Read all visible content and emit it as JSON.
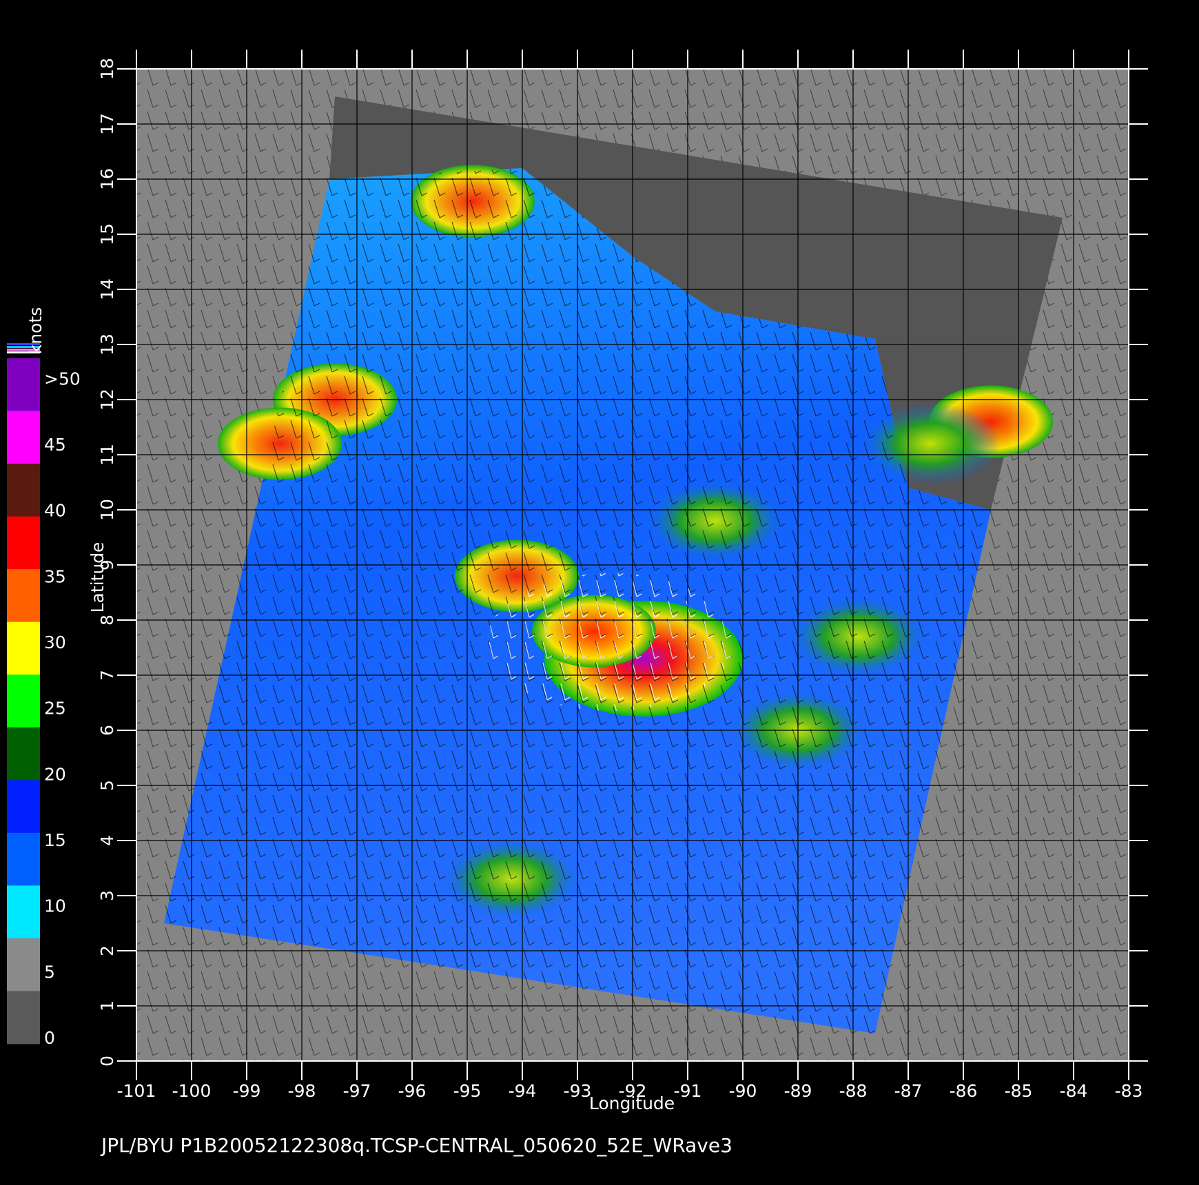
{
  "chart_data": {
    "type": "heatmap",
    "title": "",
    "xlabel": "Longitude",
    "ylabel": "Latitude",
    "xlim": [
      -101,
      -83
    ],
    "ylim": [
      0,
      18
    ],
    "x_ticks": [
      "-101",
      "-100",
      "-99",
      "-98",
      "-97",
      "-96",
      "-95",
      "-94",
      "-93",
      "-92",
      "-91",
      "-90",
      "-89",
      "-88",
      "-87",
      "-86",
      "-85",
      "-84",
      "-83"
    ],
    "y_ticks": [
      "0",
      "1",
      "2",
      "3",
      "4",
      "5",
      "6",
      "7",
      "8",
      "9",
      "10",
      "11",
      "12",
      "13",
      "14",
      "15",
      "16",
      "17",
      "18"
    ],
    "grid": true,
    "colorbar": {
      "unit": "knots",
      "labels": [
        "0",
        "5",
        "10",
        "15",
        "20",
        "25",
        "30",
        "35",
        "40",
        "45",
        ">50"
      ],
      "colors": [
        "#5a5a5a",
        "#8a8a8a",
        "#00e8ff",
        "#0060ff",
        "#0020ff",
        "#006000",
        "#00ff00",
        "#ffff00",
        "#ff6000",
        "#ff0000",
        "#5a1a10",
        "#ff00ff",
        "#8000c0"
      ]
    },
    "swath_corners": [
      [
        -97.4,
        17.5
      ],
      [
        -84.2,
        15.3
      ],
      [
        -87.6,
        0.5
      ],
      [
        -100.5,
        2.5
      ]
    ],
    "wind_features": [
      {
        "lon": -91.8,
        "lat": 7.3,
        "speed_knots": 45
      },
      {
        "lon": -92.7,
        "lat": 7.8,
        "speed_knots": 30
      },
      {
        "lon": -94.1,
        "lat": 8.8,
        "speed_knots": 27
      },
      {
        "lon": -94.9,
        "lat": 15.6,
        "speed_knots": 32
      },
      {
        "lon": -97.4,
        "lat": 12.0,
        "speed_knots": 27
      },
      {
        "lon": -98.4,
        "lat": 11.2,
        "speed_knots": 30
      },
      {
        "lon": -85.5,
        "lat": 11.6,
        "speed_knots": 28
      },
      {
        "lon": -86.6,
        "lat": 11.2,
        "speed_knots": 20
      },
      {
        "lon": -89.0,
        "lat": 6.0,
        "speed_knots": 19
      },
      {
        "lon": -94.2,
        "lat": 3.3,
        "speed_knots": 18
      },
      {
        "lon": -90.5,
        "lat": 9.8,
        "speed_knots": 17
      },
      {
        "lon": -87.9,
        "lat": 7.7,
        "speed_knots": 18
      }
    ]
  },
  "footer": "JPL/BYU  P1B20052122308q.TCSP-CENTRAL_050620_52E_WRave3"
}
